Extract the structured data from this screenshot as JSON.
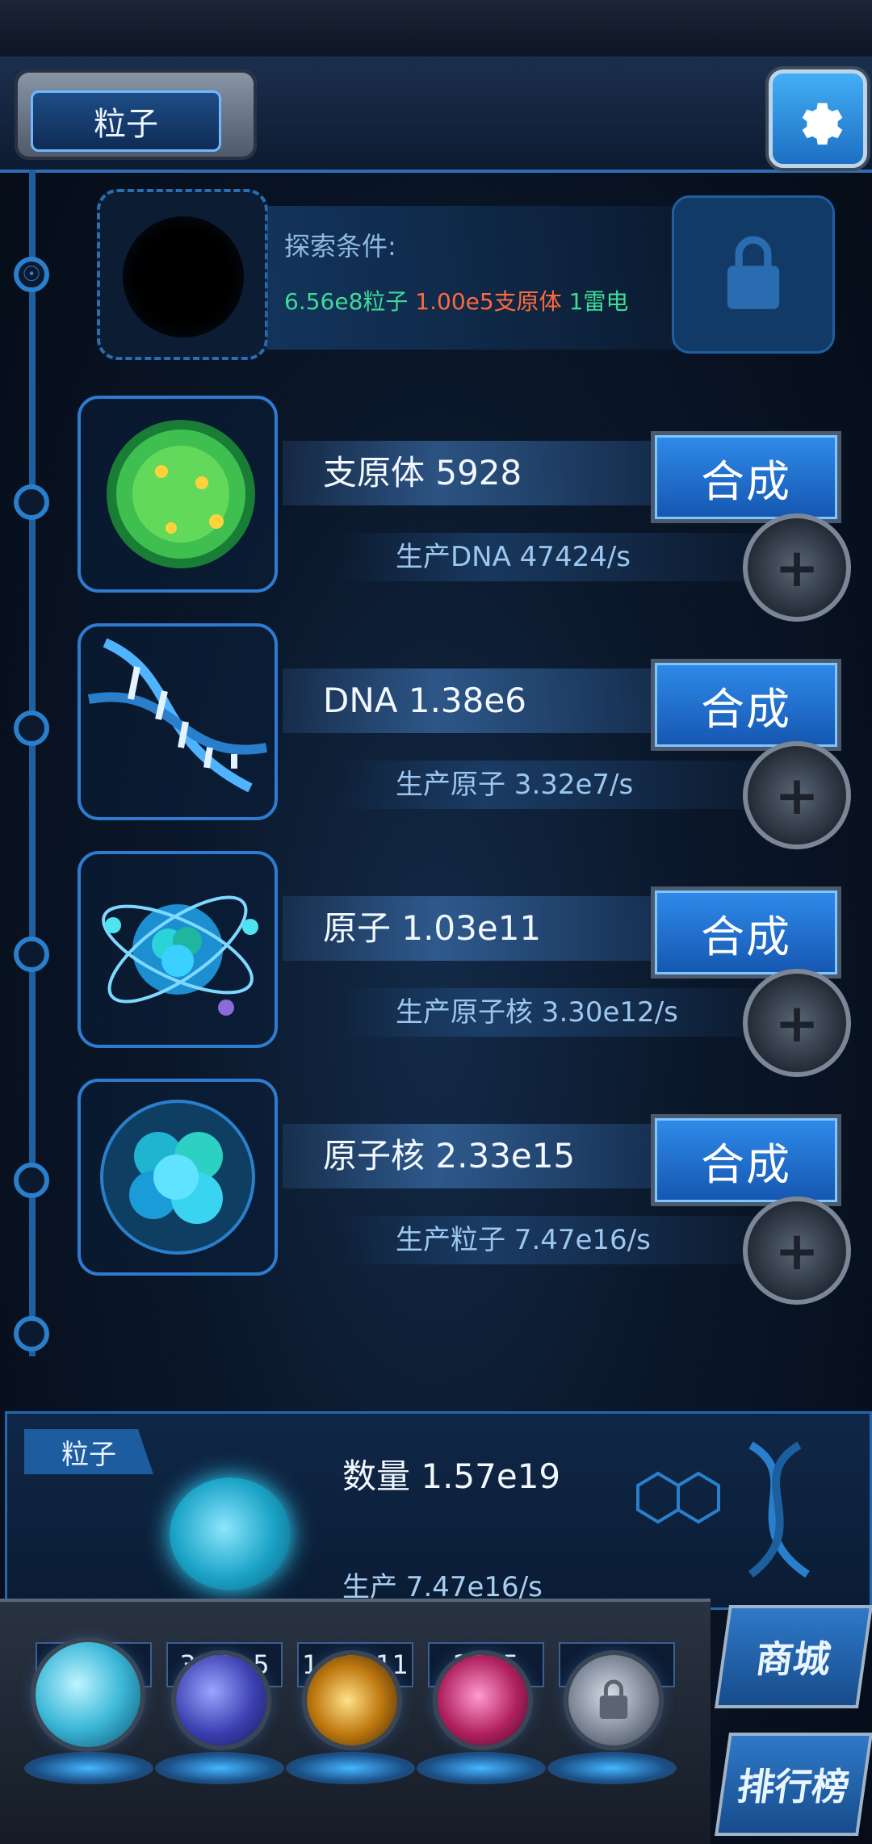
{
  "header": {
    "title": "粒子",
    "settings_icon": "gear-icon"
  },
  "explore": {
    "title": "探索条件:",
    "cond_1": "6.56e8粒子",
    "cond_2": "1.00e5支原体",
    "cond_3": "1雷电",
    "colors": {
      "cond_1": "#3ddc97",
      "cond_2": "#ff6a3d",
      "cond_3": "#3ddc97"
    }
  },
  "items": [
    {
      "name": "支原体 5928",
      "production": "生产DNA 47424/s",
      "synth_label": "合成",
      "icon": "mycoplasma-icon"
    },
    {
      "name": "DNA 1.38e6",
      "production": "生产原子 3.32e7/s",
      "synth_label": "合成",
      "icon": "dna-icon"
    },
    {
      "name": "原子 1.03e11",
      "production": "生产原子核 3.30e12/s",
      "synth_label": "合成",
      "icon": "atom-icon"
    },
    {
      "name": "原子核 2.33e15",
      "production": "生产粒子 7.47e16/s",
      "synth_label": "合成",
      "icon": "nucleus-icon"
    }
  ],
  "bottom_panel": {
    "label": "粒子",
    "quantity": "数量 1.57e19",
    "production": "生产 7.47e16/s"
  },
  "resources": [
    {
      "value": "",
      "orb": "particle-orb-icon"
    },
    {
      "value": "3.92e5",
      "orb": "lightning-orb-icon"
    },
    {
      "value": "1.40e11",
      "orb": "galaxy-orb-icon"
    },
    {
      "value": "2205",
      "orb": "brain-orb-icon"
    },
    {
      "value": "",
      "orb": "lock-orb-icon"
    }
  ],
  "side_buttons": {
    "shop": "商城",
    "rank": "排行榜"
  }
}
